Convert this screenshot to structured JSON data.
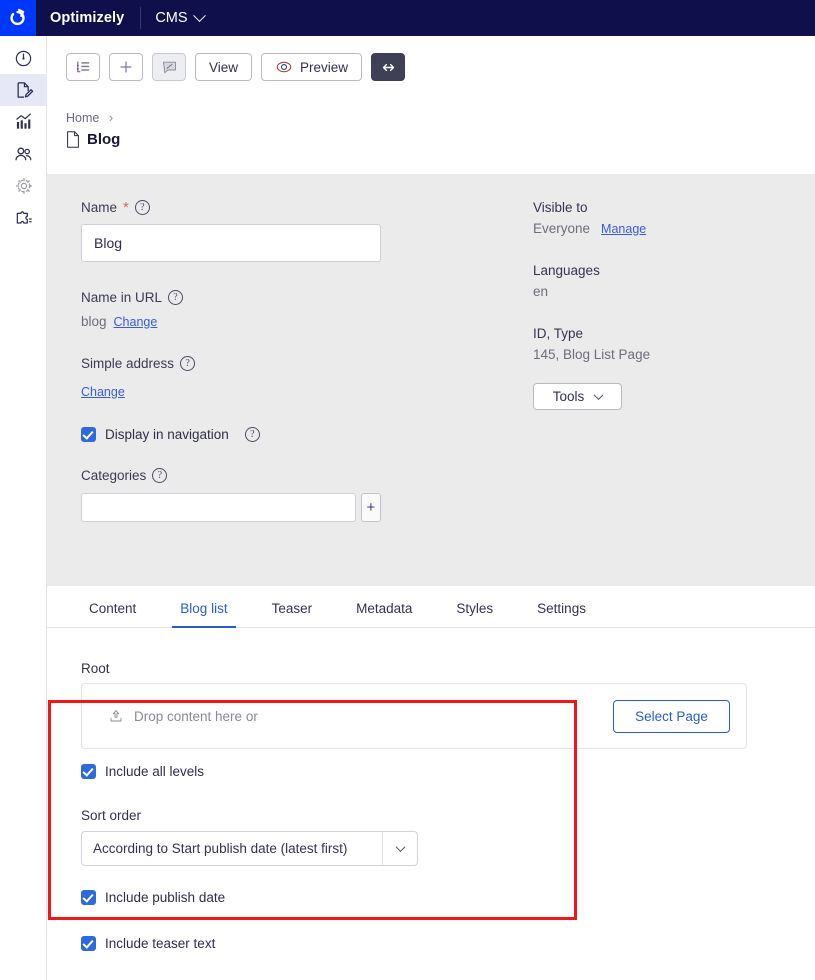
{
  "topbar": {
    "brand": "Optimizely",
    "product_menu": "CMS",
    "logo_icon": "optimizely-logo-icon",
    "caret_icon": "chevron-down-icon",
    "bg_color": "#0f0f4b",
    "logo_tile_color": "#0037ff"
  },
  "rail": {
    "items": [
      {
        "icon": "dashboard-gauge-icon",
        "name": "sidebar-item-dashboard",
        "active": false
      },
      {
        "icon": "page-edit-icon",
        "name": "sidebar-item-edit",
        "active": true
      },
      {
        "icon": "analytics-chart-icon",
        "name": "sidebar-item-analytics",
        "active": false
      },
      {
        "icon": "users-icon",
        "name": "sidebar-item-visitors",
        "active": false
      },
      {
        "icon": "gear-icon",
        "name": "sidebar-item-settings",
        "active": false
      },
      {
        "icon": "puzzle-piece-icon",
        "name": "sidebar-item-addons",
        "active": false
      }
    ],
    "active_bg": "#e6e8f7"
  },
  "toolbar": {
    "tree_toggle_icon": "tree-list-icon",
    "add_icon": "plus-icon",
    "annotate_icon": "comment-edit-icon",
    "view_label": "View",
    "preview_label": "Preview",
    "preview_icon": "eye-icon",
    "resize_icon": "expand-horizontal-icon"
  },
  "breadcrumb": {
    "home": "Home",
    "separator": "›",
    "current": "Blog",
    "page_icon": "document-icon"
  },
  "form": {
    "name_label": "Name",
    "name_required": "*",
    "name_value": "Blog",
    "name_placeholder": "",
    "url_label": "Name in URL",
    "url_value": "blog",
    "url_change": "Change",
    "simple_address_label": "Simple address",
    "simple_address_change": "Change",
    "display_nav_label": "Display in navigation",
    "display_nav_checked": true,
    "categories_label": "Categories",
    "categories_value": "",
    "categories_placeholder": "",
    "add_category_icon": "plus-icon",
    "help_icon": "question-mark-icon",
    "panel_bg": "#ebebeb"
  },
  "sidepanel": {
    "visible_to_label": "Visible to",
    "visible_to_value": "Everyone",
    "visible_to_action": "Manage",
    "languages_label": "Languages",
    "languages_value": "en",
    "id_type_label": "ID, Type",
    "id_type_value": "145, Blog List Page",
    "tools_label": "Tools",
    "tools_caret_icon": "chevron-down-icon"
  },
  "tabs": {
    "items": [
      {
        "label": "Content",
        "active": false
      },
      {
        "label": "Blog list",
        "active": true
      },
      {
        "label": "Teaser",
        "active": false
      },
      {
        "label": "Metadata",
        "active": false
      },
      {
        "label": "Styles",
        "active": false
      },
      {
        "label": "Settings",
        "active": false
      }
    ],
    "active_color": "#2a5bd7"
  },
  "bloglist": {
    "root_label": "Root",
    "dropzone_text": "Drop content here or",
    "dropzone_icon": "upload-icon",
    "select_page_label": "Select Page",
    "include_all_levels_label": "Include all levels",
    "include_all_levels_checked": true,
    "sort_order_label": "Sort order",
    "sort_order_value": "According to Start publish date (latest first)",
    "sort_order_caret_icon": "chevron-down-icon",
    "include_publish_date_label": "Include publish date",
    "include_publish_date_checked": true,
    "include_teaser_text_label": "Include teaser text",
    "include_teaser_text_checked": true
  },
  "annotation": {
    "type": "highlight-rectangle",
    "color": "#f31616"
  }
}
